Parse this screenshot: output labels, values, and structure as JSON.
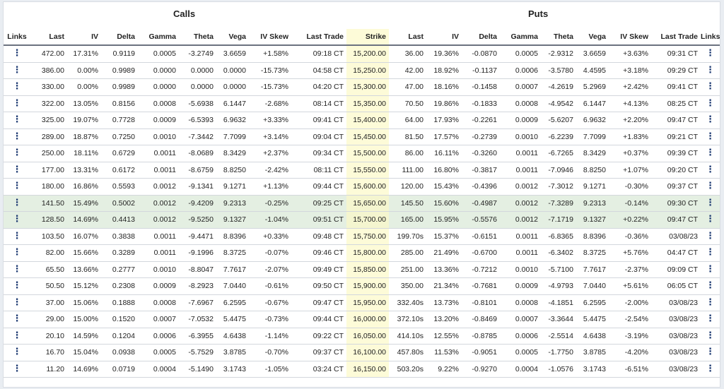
{
  "groups": {
    "calls": "Calls",
    "puts": "Puts"
  },
  "columns": [
    "Links",
    "Last",
    "IV",
    "Delta",
    "Gamma",
    "Theta",
    "Vega",
    "IV Skew",
    "Last Trade",
    "Strike",
    "Last",
    "IV",
    "Delta",
    "Gamma",
    "Theta",
    "Vega",
    "IV Skew",
    "Last Trade",
    "Links"
  ],
  "link_icon": "more-vertical-icon",
  "rows": [
    [
      "472.00",
      "17.31%",
      "0.9119",
      "0.0005",
      "-3.2749",
      "3.6659",
      "+1.58%",
      "09:18 CT",
      "15,200.00",
      "36.00",
      "19.36%",
      "-0.0870",
      "0.0005",
      "-2.9312",
      "3.6659",
      "+3.63%",
      "09:31 CT"
    ],
    [
      "386.00",
      "0.00%",
      "0.9989",
      "0.0000",
      "0.0000",
      "0.0000",
      "-15.73%",
      "04:58 CT",
      "15,250.00",
      "42.00",
      "18.92%",
      "-0.1137",
      "0.0006",
      "-3.5780",
      "4.4595",
      "+3.18%",
      "09:29 CT"
    ],
    [
      "330.00",
      "0.00%",
      "0.9989",
      "0.0000",
      "0.0000",
      "0.0000",
      "-15.73%",
      "04:20 CT",
      "15,300.00",
      "47.00",
      "18.16%",
      "-0.1458",
      "0.0007",
      "-4.2619",
      "5.2969",
      "+2.42%",
      "09:41 CT"
    ],
    [
      "322.00",
      "13.05%",
      "0.8156",
      "0.0008",
      "-5.6938",
      "6.1447",
      "-2.68%",
      "08:14 CT",
      "15,350.00",
      "70.50",
      "19.86%",
      "-0.1833",
      "0.0008",
      "-4.9542",
      "6.1447",
      "+4.13%",
      "08:25 CT"
    ],
    [
      "325.00",
      "19.07%",
      "0.7728",
      "0.0009",
      "-6.5393",
      "6.9632",
      "+3.33%",
      "09:41 CT",
      "15,400.00",
      "64.00",
      "17.93%",
      "-0.2261",
      "0.0009",
      "-5.6207",
      "6.9632",
      "+2.20%",
      "09:47 CT"
    ],
    [
      "289.00",
      "18.87%",
      "0.7250",
      "0.0010",
      "-7.3442",
      "7.7099",
      "+3.14%",
      "09:04 CT",
      "15,450.00",
      "81.50",
      "17.57%",
      "-0.2739",
      "0.0010",
      "-6.2239",
      "7.7099",
      "+1.83%",
      "09:21 CT"
    ],
    [
      "250.00",
      "18.11%",
      "0.6729",
      "0.0011",
      "-8.0689",
      "8.3429",
      "+2.37%",
      "09:34 CT",
      "15,500.00",
      "86.00",
      "16.11%",
      "-0.3260",
      "0.0011",
      "-6.7265",
      "8.3429",
      "+0.37%",
      "09:39 CT"
    ],
    [
      "177.00",
      "13.31%",
      "0.6172",
      "0.0011",
      "-8.6759",
      "8.8250",
      "-2.42%",
      "08:11 CT",
      "15,550.00",
      "111.00",
      "16.80%",
      "-0.3817",
      "0.0011",
      "-7.0946",
      "8.8250",
      "+1.07%",
      "09:20 CT"
    ],
    [
      "180.00",
      "16.86%",
      "0.5593",
      "0.0012",
      "-9.1341",
      "9.1271",
      "+1.13%",
      "09:44 CT",
      "15,600.00",
      "120.00",
      "15.43%",
      "-0.4396",
      "0.0012",
      "-7.3012",
      "9.1271",
      "-0.30%",
      "09:37 CT"
    ],
    [
      "141.50",
      "15.49%",
      "0.5002",
      "0.0012",
      "-9.4209",
      "9.2313",
      "-0.25%",
      "09:25 CT",
      "15,650.00",
      "145.50",
      "15.60%",
      "-0.4987",
      "0.0012",
      "-7.3289",
      "9.2313",
      "-0.14%",
      "09:30 CT"
    ],
    [
      "128.50",
      "14.69%",
      "0.4413",
      "0.0012",
      "-9.5250",
      "9.1327",
      "-1.04%",
      "09:51 CT",
      "15,700.00",
      "165.00",
      "15.95%",
      "-0.5576",
      "0.0012",
      "-7.1719",
      "9.1327",
      "+0.22%",
      "09:47 CT"
    ],
    [
      "103.50",
      "16.07%",
      "0.3838",
      "0.0011",
      "-9.4471",
      "8.8396",
      "+0.33%",
      "09:48 CT",
      "15,750.00",
      "199.70s",
      "15.37%",
      "-0.6151",
      "0.0011",
      "-6.8365",
      "8.8396",
      "-0.36%",
      "03/08/23"
    ],
    [
      "82.00",
      "15.66%",
      "0.3289",
      "0.0011",
      "-9.1996",
      "8.3725",
      "-0.07%",
      "09:46 CT",
      "15,800.00",
      "285.00",
      "21.49%",
      "-0.6700",
      "0.0011",
      "-6.3402",
      "8.3725",
      "+5.76%",
      "04:47 CT"
    ],
    [
      "65.50",
      "13.66%",
      "0.2777",
      "0.0010",
      "-8.8047",
      "7.7617",
      "-2.07%",
      "09:49 CT",
      "15,850.00",
      "251.00",
      "13.36%",
      "-0.7212",
      "0.0010",
      "-5.7100",
      "7.7617",
      "-2.37%",
      "09:09 CT"
    ],
    [
      "50.50",
      "15.12%",
      "0.2308",
      "0.0009",
      "-8.2923",
      "7.0440",
      "-0.61%",
      "09:50 CT",
      "15,900.00",
      "350.00",
      "21.34%",
      "-0.7681",
      "0.0009",
      "-4.9793",
      "7.0440",
      "+5.61%",
      "06:05 CT"
    ],
    [
      "37.00",
      "15.06%",
      "0.1888",
      "0.0008",
      "-7.6967",
      "6.2595",
      "-0.67%",
      "09:47 CT",
      "15,950.00",
      "332.40s",
      "13.73%",
      "-0.8101",
      "0.0008",
      "-4.1851",
      "6.2595",
      "-2.00%",
      "03/08/23"
    ],
    [
      "29.00",
      "15.00%",
      "0.1520",
      "0.0007",
      "-7.0532",
      "5.4475",
      "-0.73%",
      "09:44 CT",
      "16,000.00",
      "372.10s",
      "13.20%",
      "-0.8469",
      "0.0007",
      "-3.3644",
      "5.4475",
      "-2.54%",
      "03/08/23"
    ],
    [
      "20.10",
      "14.59%",
      "0.1204",
      "0.0006",
      "-6.3955",
      "4.6438",
      "-1.14%",
      "09:22 CT",
      "16,050.00",
      "414.10s",
      "12.55%",
      "-0.8785",
      "0.0006",
      "-2.5514",
      "4.6438",
      "-3.19%",
      "03/08/23"
    ],
    [
      "16.70",
      "15.04%",
      "0.0938",
      "0.0005",
      "-5.7529",
      "3.8785",
      "-0.70%",
      "09:37 CT",
      "16,100.00",
      "457.80s",
      "11.53%",
      "-0.9051",
      "0.0005",
      "-1.7750",
      "3.8785",
      "-4.20%",
      "03/08/23"
    ],
    [
      "11.20",
      "14.69%",
      "0.0719",
      "0.0004",
      "-5.1490",
      "3.1743",
      "-1.05%",
      "03:24 CT",
      "16,150.00",
      "503.20s",
      "9.22%",
      "-0.9270",
      "0.0004",
      "-1.0576",
      "3.1743",
      "-6.51%",
      "03/08/23"
    ]
  ],
  "highlighted_rows": [
    9,
    10
  ]
}
